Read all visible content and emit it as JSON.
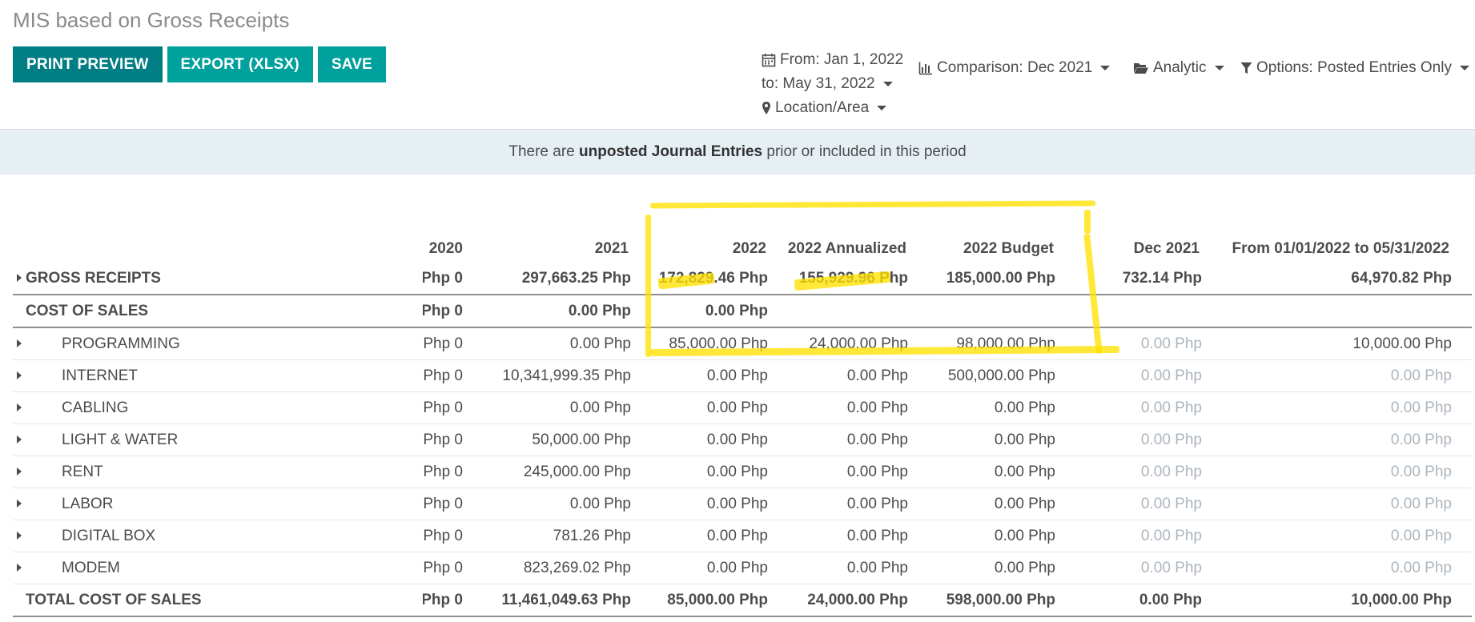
{
  "page": {
    "title": "MIS based on Gross Receipts"
  },
  "toolbar": {
    "print_preview": "PRINT PREVIEW",
    "export": "EXPORT (XLSX)",
    "save": "SAVE"
  },
  "filters": {
    "date_from": "From: Jan 1, 2022",
    "date_to": "to: May 31, 2022",
    "location": "Location/Area",
    "comparison": "Comparison: Dec 2021",
    "analytic": "Analytic",
    "options": "Options: Posted Entries Only"
  },
  "alert": {
    "prefix": "There are",
    "bold": "unposted Journal Entries",
    "suffix": "prior or included in this period"
  },
  "table": {
    "columns": [
      "2020",
      "2021",
      "2022",
      "2022 Annualized",
      "2022 Budget",
      "Dec 2021",
      "From 01/01/2022 to 05/31/2022"
    ],
    "rows": [
      {
        "label": "GROSS RECEIPTS",
        "cells": [
          "0 Php",
          "297,663.25 Php",
          "172,829.46 Php",
          "155,929.96 Php",
          "185,000.00 Php",
          "732.14 Php",
          "64,970.82 Php"
        ]
      },
      {
        "label": "COST OF SALES",
        "cells": [
          "0 Php",
          "0.00 Php",
          "0.00 Php",
          "",
          "",
          "",
          ""
        ]
      },
      {
        "label": "PROGRAMMING",
        "cells": [
          "0 Php",
          "0.00 Php",
          "85,000.00 Php",
          "24,000.00 Php",
          "98,000.00 Php",
          "0.00 Php",
          "10,000.00 Php"
        ]
      },
      {
        "label": "INTERNET",
        "cells": [
          "0 Php",
          "10,341,999.35 Php",
          "0.00 Php",
          "0.00 Php",
          "500,000.00 Php",
          "0.00 Php",
          "0.00 Php"
        ]
      },
      {
        "label": "CABLING",
        "cells": [
          "0 Php",
          "0.00 Php",
          "0.00 Php",
          "0.00 Php",
          "0.00 Php",
          "0.00 Php",
          "0.00 Php"
        ]
      },
      {
        "label": "LIGHT & WATER",
        "cells": [
          "0 Php",
          "50,000.00 Php",
          "0.00 Php",
          "0.00 Php",
          "0.00 Php",
          "0.00 Php",
          "0.00 Php"
        ]
      },
      {
        "label": "RENT",
        "cells": [
          "0 Php",
          "245,000.00 Php",
          "0.00 Php",
          "0.00 Php",
          "0.00 Php",
          "0.00 Php",
          "0.00 Php"
        ]
      },
      {
        "label": "LABOR",
        "cells": [
          "0 Php",
          "0.00 Php",
          "0.00 Php",
          "0.00 Php",
          "0.00 Php",
          "0.00 Php",
          "0.00 Php"
        ]
      },
      {
        "label": "DIGITAL BOX",
        "cells": [
          "0 Php",
          "781.26 Php",
          "0.00 Php",
          "0.00 Php",
          "0.00 Php",
          "0.00 Php",
          "0.00 Php"
        ]
      },
      {
        "label": "MODEM",
        "cells": [
          "0 Php",
          "823,269.02 Php",
          "0.00 Php",
          "0.00 Php",
          "0.00 Php",
          "0.00 Php",
          "0.00 Php"
        ]
      },
      {
        "label": "TOTAL COST OF SALES",
        "cells": [
          "0 Php",
          "11,461,049.63 Php",
          "85,000.00 Php",
          "24,000.00 Php",
          "598,000.00 Php",
          "0.00 Php",
          "10,000.00 Php"
        ]
      }
    ]
  },
  "colors": {
    "primary": "#017e84",
    "secondary": "#00a09d",
    "alert_bg": "#e6f0f4",
    "highlight": "#ffe200"
  }
}
